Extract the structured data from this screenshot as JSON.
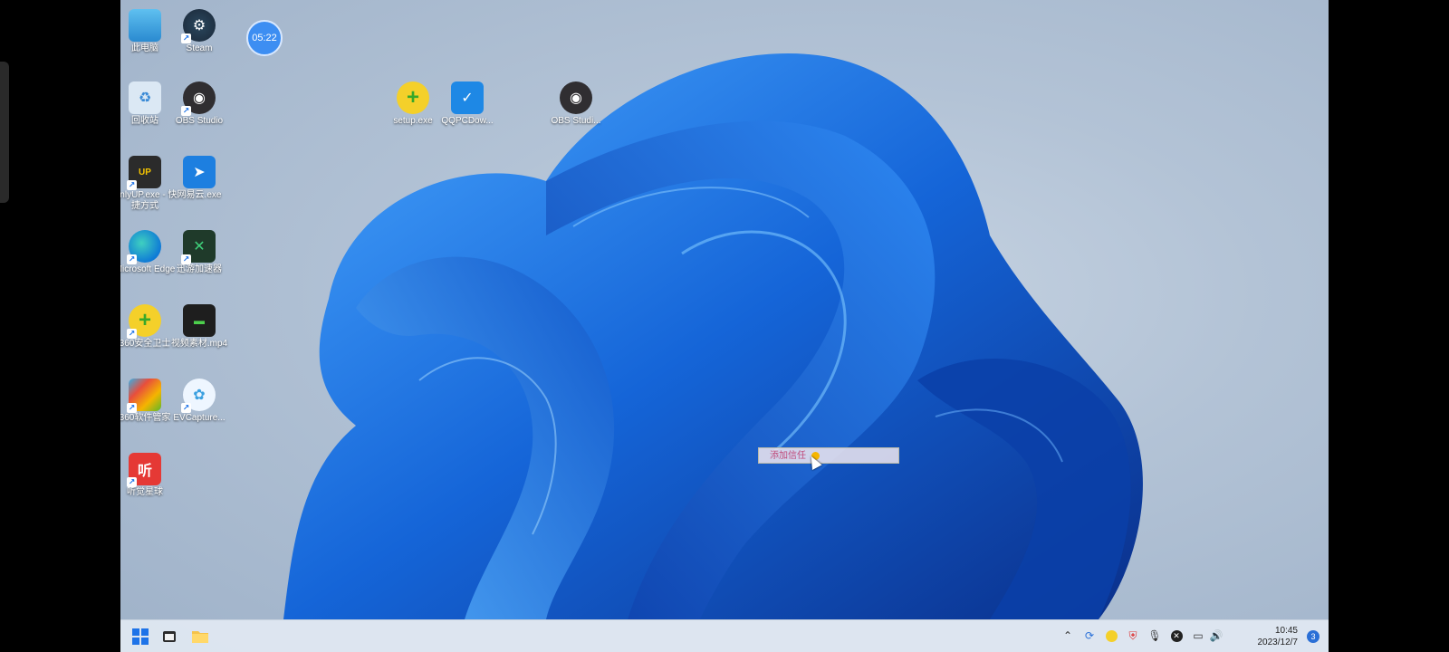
{
  "desktop": {
    "clock_bubble": "05:22",
    "icons": [
      {
        "label": "此电脑",
        "icon": "computer-icon",
        "color": "#3aa0e0"
      },
      {
        "label": "Steam",
        "icon": "steam-icon",
        "color": "#1b2838"
      },
      {
        "label": "回收站",
        "icon": "recycle-bin-icon",
        "color": "#6ab0e8"
      },
      {
        "label": "OBS Studio",
        "icon": "obs-icon",
        "color": "#302e31"
      },
      {
        "label": "OnlyUP.exe - 快捷方式",
        "icon": "onlyup-icon",
        "color": "#d8a000"
      },
      {
        "label": "网易云.exe",
        "icon": "app-arrow-icon",
        "color": "#1d7fe0"
      },
      {
        "label": "Microsoft Edge",
        "icon": "edge-icon",
        "color": "#0f7bd6"
      },
      {
        "label": "迅游加速器",
        "icon": "xunyou-icon",
        "color": "#1c9a54"
      },
      {
        "label": "360安全卫士",
        "icon": "360-guard-icon",
        "color": "#37a829"
      },
      {
        "label": "视频素材.mp4",
        "icon": "video-file-icon",
        "color": "#2c8a2c"
      },
      {
        "label": "360软件管家",
        "icon": "360-softmgr-icon",
        "color": "#e84e3c"
      },
      {
        "label": "EVCapture...",
        "icon": "evcapture-icon",
        "color": "#3aa0e0"
      },
      {
        "label": "听觉星球",
        "icon": "audio-app-icon",
        "color": "#e53935"
      },
      {
        "label": "setup.exe",
        "icon": "setup-icon",
        "color": "#5cb82a"
      },
      {
        "label": "QQPCDow...",
        "icon": "qqpc-icon",
        "color": "#1e88e5"
      },
      {
        "label": "OBS Studi...",
        "icon": "obs-installer-icon",
        "color": "#302e31"
      }
    ]
  },
  "tooltip": {
    "text": "添加信任"
  },
  "taskbar": {
    "start_icon": "windows-start-icon",
    "apps": [
      "terminal-icon",
      "file-explorer-icon"
    ],
    "tray": [
      "chevron-up-icon",
      "sync-icon",
      "360-tray-icon",
      "shield-tray-icon",
      "microphone-icon",
      "close-circle-icon",
      "network-icon",
      "speaker-icon"
    ],
    "time": "10:45",
    "date": "2023/12/7",
    "notifications": "3"
  },
  "colors": {
    "accent": "#0f6fdb",
    "taskbar": "#e1e8f2"
  }
}
